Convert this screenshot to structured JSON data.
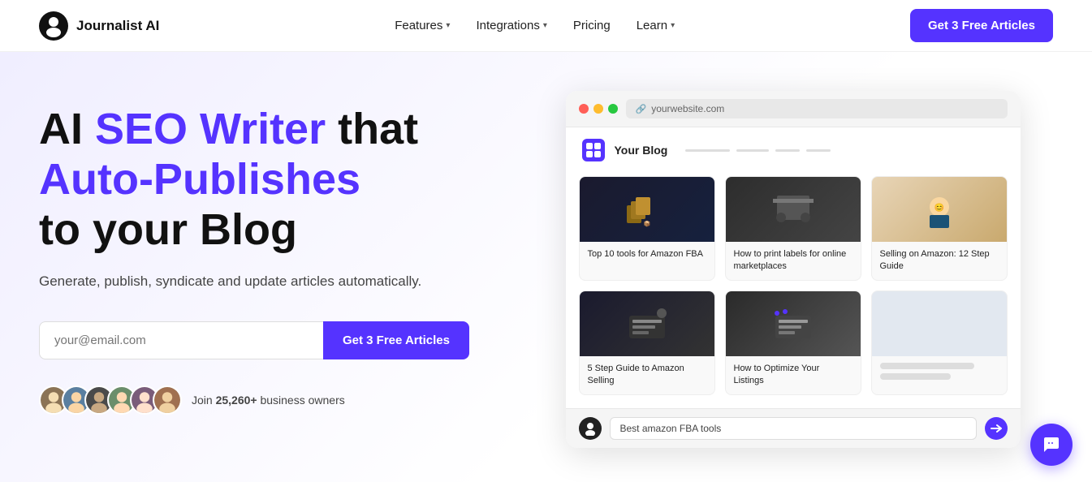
{
  "nav": {
    "logo_text": "Journalist AI",
    "links": [
      {
        "label": "Features",
        "has_dropdown": true
      },
      {
        "label": "Integrations",
        "has_dropdown": true
      },
      {
        "label": "Pricing",
        "has_dropdown": false
      },
      {
        "label": "Learn",
        "has_dropdown": true
      }
    ],
    "cta_label": "Get 3 Free Articles"
  },
  "hero": {
    "title_part1": "AI ",
    "title_purple": "SEO Writer",
    "title_part2": " that",
    "title_line2_purple": "Auto-Publishes",
    "title_line3": "to your Blog",
    "subtitle": "Generate, publish, syndicate and update articles automatically.",
    "email_placeholder": "your@email.com",
    "cta_label": "Get 3 Free Articles",
    "social_text_pre": "Join ",
    "social_count": "25,260+",
    "social_text_post": " business owners"
  },
  "browser": {
    "url": "yourwebsite.com",
    "blog_name": "Your Blog",
    "chat_placeholder": "Best amazon FBA tools",
    "articles": [
      {
        "id": 1,
        "title": "Top 10 tools for Amazon FBA",
        "img_type": "fba"
      },
      {
        "id": 2,
        "title": "How to print labels for online marketplaces",
        "img_type": "labels"
      },
      {
        "id": 3,
        "title": "Selling on Amazon: 12 Step Guide",
        "img_type": "selling"
      },
      {
        "id": 4,
        "title": "5 Step Guide to Amazon Selling",
        "img_type": "step"
      },
      {
        "id": 5,
        "title": "How to Optimize Your Listings",
        "img_type": "optimize"
      },
      {
        "id": 6,
        "title": "",
        "img_type": "empty"
      }
    ]
  },
  "floating_chat": {
    "icon": "chat-icon"
  }
}
